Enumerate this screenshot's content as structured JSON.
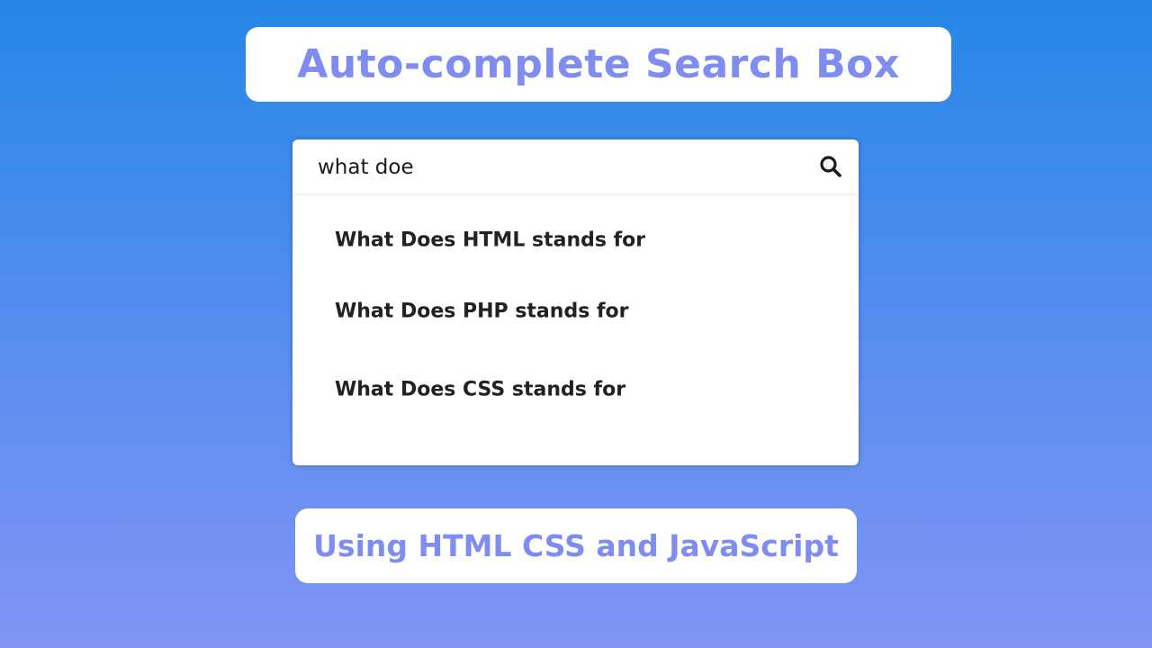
{
  "title": "Auto-complete Search Box",
  "search": {
    "value": "what doe",
    "icon": "search-icon"
  },
  "suggestions": [
    "What Does HTML stands for",
    "What Does PHP stands for",
    "What Does CSS stands for"
  ],
  "subtitle": "Using HTML CSS and JavaScript",
  "colors": {
    "accent_text": "#7f8cf0",
    "gradient_top": "#2587e6",
    "gradient_bottom": "#8194f5"
  }
}
